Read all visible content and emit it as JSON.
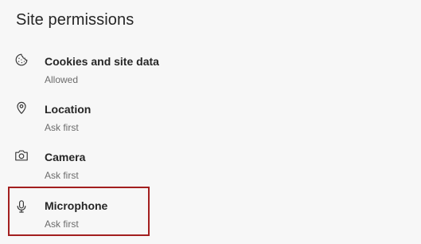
{
  "page": {
    "title": "Site permissions"
  },
  "permissions": [
    {
      "label": "Cookies and site data",
      "status": "Allowed",
      "icon": "cookie-icon"
    },
    {
      "label": "Location",
      "status": "Ask first",
      "icon": "location-pin-icon"
    },
    {
      "label": "Camera",
      "status": "Ask first",
      "icon": "camera-icon"
    },
    {
      "label": "Microphone",
      "status": "Ask first",
      "icon": "microphone-icon",
      "highlighted": true
    }
  ],
  "colors": {
    "background": "#f7f7f7",
    "highlight_border": "#a31f1f",
    "label_text": "#262626",
    "status_text": "#6b6b6b"
  }
}
